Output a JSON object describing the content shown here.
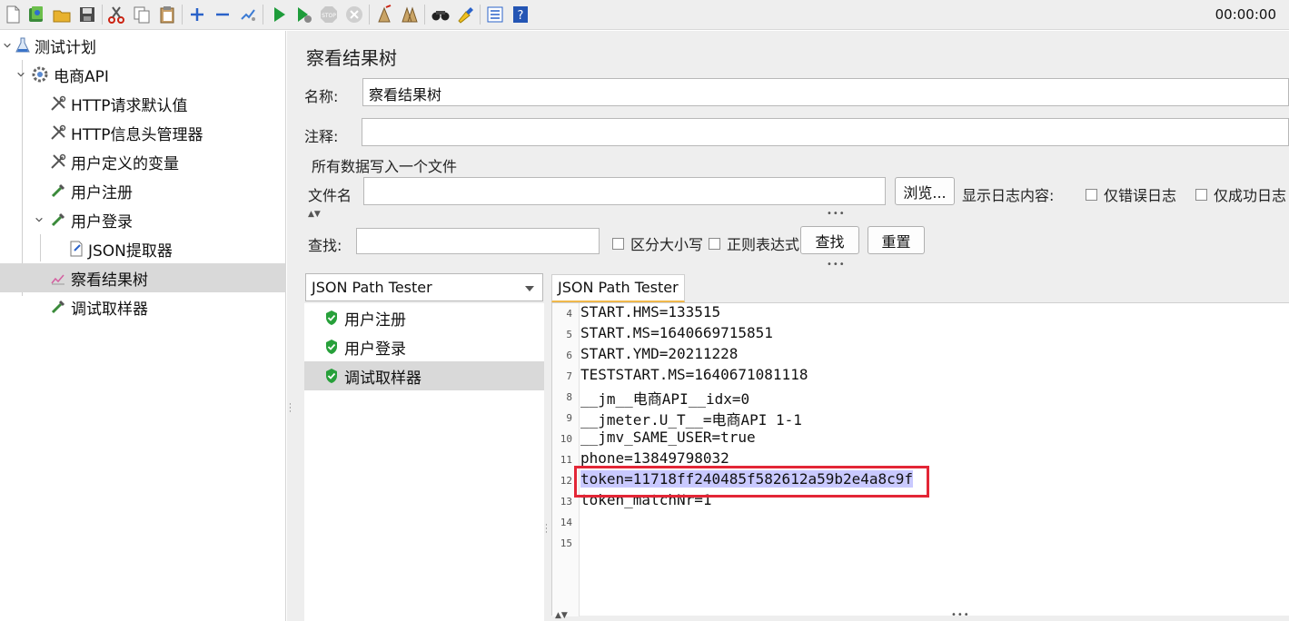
{
  "toolbar": {
    "buttons": [
      "new-icon",
      "templates-icon",
      "open-icon",
      "save-icon",
      "cut-icon",
      "copy-icon",
      "paste-icon",
      "expand-icon",
      "collapse-icon",
      "toggle-icon",
      "start-icon",
      "start-no-pause-icon",
      "stop-icon",
      "shutdown-icon",
      "clear-icon",
      "clear-all-icon",
      "search-icon",
      "reset-search-icon",
      "function-helper-icon",
      "help-icon"
    ],
    "timer": "00:00:00"
  },
  "tree": {
    "items": [
      {
        "label": "测试计划",
        "icon": "flask-icon"
      },
      {
        "label": "电商API",
        "icon": "gear-icon"
      },
      {
        "label": "HTTP请求默认值",
        "icon": "tools-icon"
      },
      {
        "label": "HTTP信息头管理器",
        "icon": "tools-icon"
      },
      {
        "label": "用户定义的变量",
        "icon": "tools-icon"
      },
      {
        "label": "用户注册",
        "icon": "pipette-icon"
      },
      {
        "label": "用户登录",
        "icon": "pipette-icon"
      },
      {
        "label": "JSON提取器",
        "icon": "extractor-icon"
      },
      {
        "label": "察看结果树",
        "icon": "chart-icon"
      },
      {
        "label": "调试取样器",
        "icon": "pipette-icon"
      }
    ]
  },
  "panel": {
    "title": "察看结果树",
    "name_label": "名称:",
    "name_value": "察看结果树",
    "comment_label": "注释:",
    "comment_value": "",
    "file_group": "所有数据写入一个文件",
    "filename_label": "文件名",
    "filename_value": "",
    "browse": "浏览...",
    "log_label": "显示日志内容:",
    "errors_only": "仅错误日志",
    "success_only": "仅成功日志",
    "search_label": "查找:",
    "search_value": "",
    "case_sensitive": "区分大小写",
    "regex": "正则表达式",
    "find": "查找",
    "reset": "重置"
  },
  "results": {
    "renderer": "JSON Path Tester",
    "items": [
      "用户注册",
      "用户登录",
      "调试取样器"
    ],
    "tab": "JSON Path Tester",
    "lines": [
      {
        "n": "4",
        "text": "START.HMS=133515"
      },
      {
        "n": "5",
        "text": "START.MS=1640669715851"
      },
      {
        "n": "6",
        "text": "START.YMD=20211228"
      },
      {
        "n": "7",
        "text": "TESTSTART.MS=1640671081118"
      },
      {
        "n": "8",
        "text": "__jm__电商API__idx=0"
      },
      {
        "n": "9",
        "text": "__jmeter.U_T__=电商API 1-1"
      },
      {
        "n": "10",
        "text": "__jmv_SAME_USER=true"
      },
      {
        "n": "11",
        "text": "phone=13849798032"
      },
      {
        "n": "12",
        "text": "token=11718ff240485f582612a59b2e4a8c9f"
      },
      {
        "n": "13",
        "text": "token_matchNr=1"
      },
      {
        "n": "14",
        "text": ""
      },
      {
        "n": "15",
        "text": ""
      }
    ]
  }
}
